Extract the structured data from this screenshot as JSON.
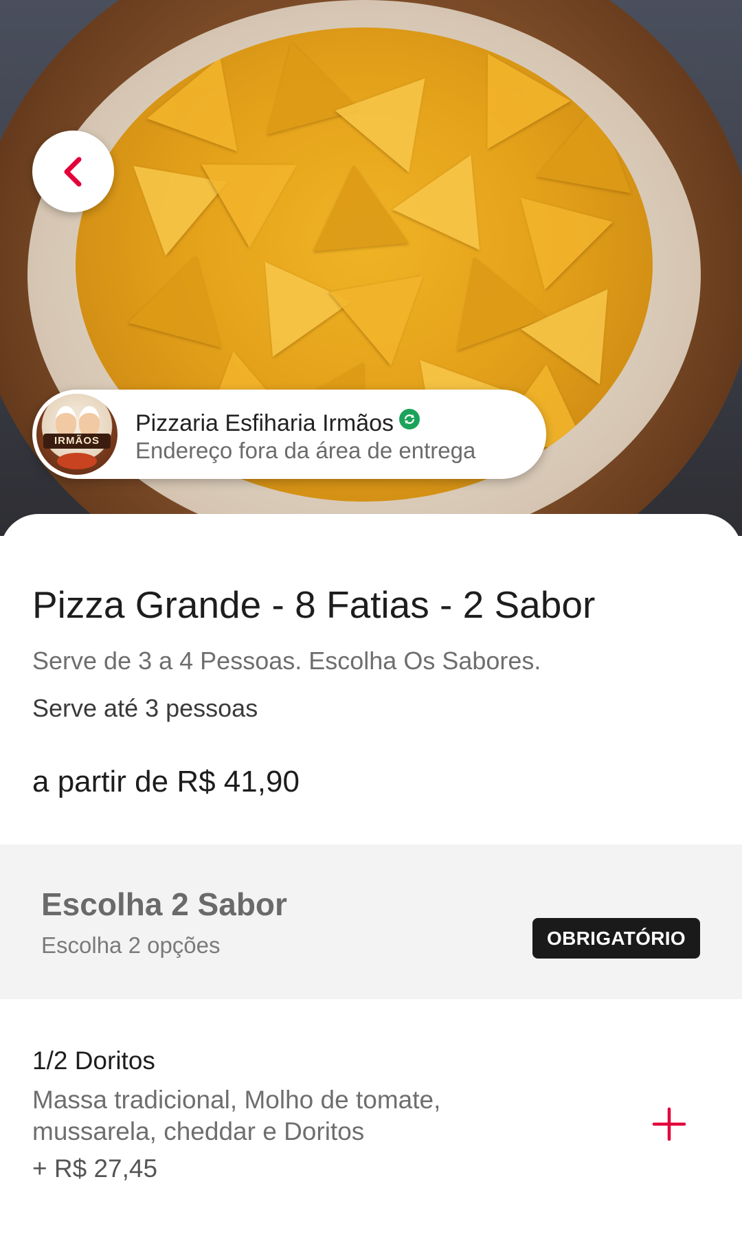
{
  "hero": {
    "back_icon": "chevron-left-icon",
    "accent_color": "#e3003b"
  },
  "store": {
    "name": "Pizzaria Esfiharia Irmãos",
    "delivery_status": "Endereço fora da área de entrega",
    "logo_text": "IRMÃOS",
    "verified_icon": "verified-check-icon",
    "verified_color": "#1aa35a"
  },
  "product": {
    "title": "Pizza Grande - 8 Fatias - 2 Sabor",
    "description": "Serve de 3 a 4 Pessoas. Escolha Os Sabores.",
    "serves": "Serve até 3 pessoas",
    "price": "a partir de R$ 41,90"
  },
  "group": {
    "title": "Escolha 2 Sabor",
    "subtitle": "Escolha 2 opções",
    "badge": "OBRIGATÓRIO"
  },
  "options": [
    {
      "name": "1/2 Doritos",
      "description": "Massa tradicional, Molho de tomate, mussarela, cheddar e Doritos",
      "price": "+ R$ 27,45",
      "add_icon": "plus-icon"
    }
  ]
}
